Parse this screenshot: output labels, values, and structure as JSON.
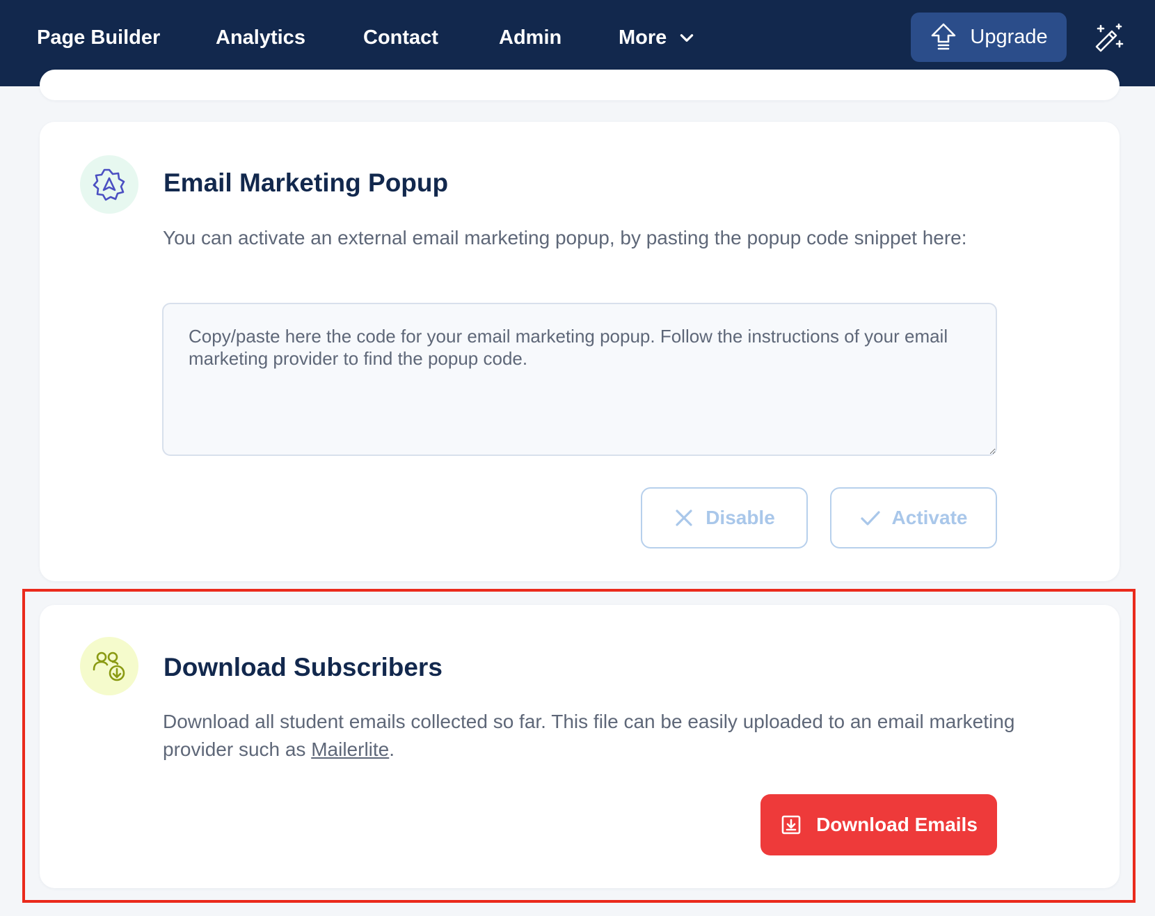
{
  "nav": {
    "links": [
      "Page Builder",
      "Analytics",
      "Contact",
      "Admin",
      "More"
    ],
    "more_icon": "chevron-down-icon",
    "upgrade_label": "Upgrade",
    "upgrade_icon": "upload-arrow-icon",
    "magic_icon": "magic-wand-icon"
  },
  "popup_card": {
    "icon": "badge-settings-icon",
    "title": "Email Marketing Popup",
    "description": "You can activate an external email marketing popup, by pasting the popup code snippet here:",
    "textarea_value": "",
    "textarea_placeholder": "Copy/paste here the code for your email marketing popup. Follow the instructions of your email marketing provider to find the popup code.",
    "disable_label": "Disable",
    "activate_label": "Activate"
  },
  "download_card": {
    "icon": "users-download-icon",
    "title": "Download Subscribers",
    "description_before": "Download all student emails collected so far. This file can be easily uploaded to an email marketing provider such as ",
    "link_text": "Mailerlite",
    "description_after": ".",
    "button_label": "Download Emails",
    "button_icon": "download-tray-icon"
  },
  "colors": {
    "nav_bg": "#12284d",
    "upgrade_bg": "#2b4d8a",
    "download_btn": "#ee3a3a",
    "disabled_btn_text": "#a9c7ea",
    "highlight": "#ea2a1c"
  }
}
